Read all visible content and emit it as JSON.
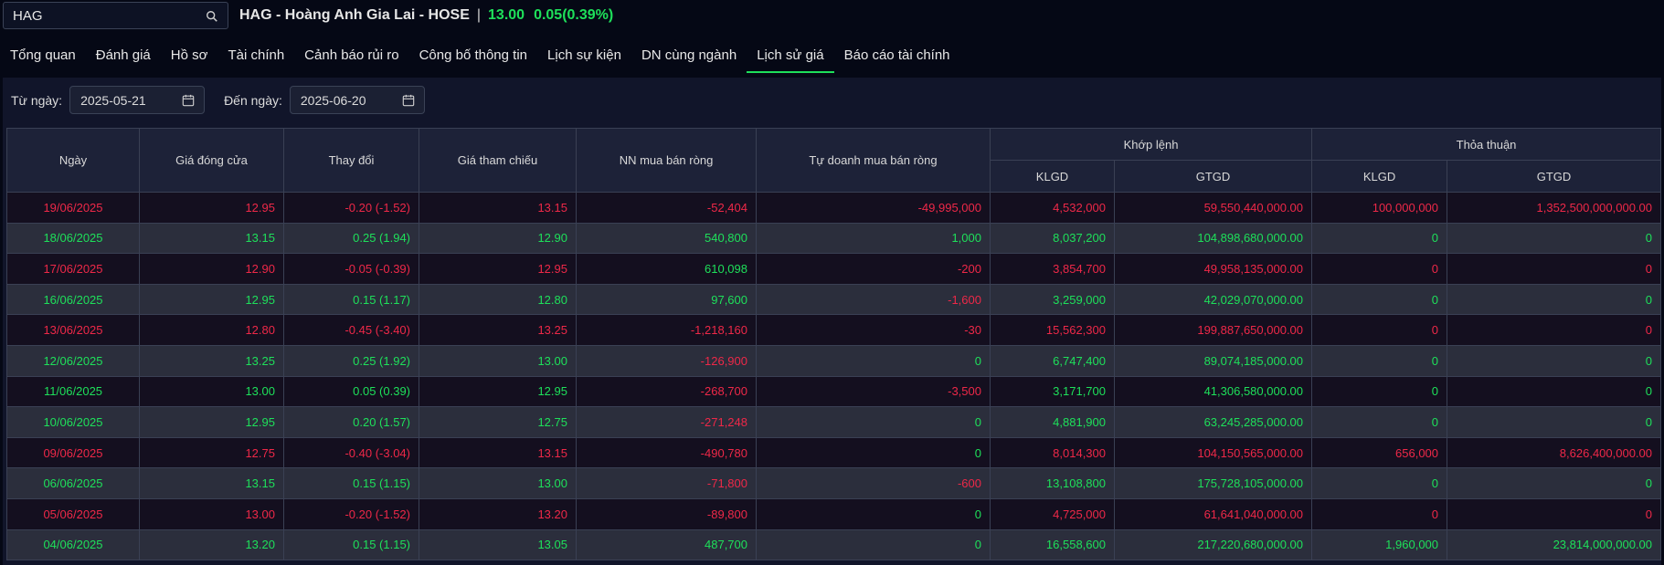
{
  "search": {
    "value": "HAG"
  },
  "header": {
    "stock_title": "HAG - Hoàng Anh Gia Lai - HOSE",
    "separator": "|",
    "price": "13.00",
    "change": "0.05(0.39%)"
  },
  "tabs": [
    "Tổng quan",
    "Đánh giá",
    "Hồ sơ",
    "Tài chính",
    "Cảnh báo rủi ro",
    "Công bố thông tin",
    "Lịch sự kiện",
    "DN cùng ngành",
    "Lịch sử giá",
    "Báo cáo tài chính"
  ],
  "active_tab": "Lịch sử giá",
  "filters": {
    "from_label": "Từ ngày:",
    "from_value": "2025-05-21",
    "to_label": "Đến ngày:",
    "to_value": "2025-06-20"
  },
  "table": {
    "headers": {
      "date": "Ngày",
      "close": "Giá đóng cửa",
      "change": "Thay đổi",
      "ref": "Giá tham chiếu",
      "foreign": "NN mua bán ròng",
      "prop": "Tự doanh mua bán ròng",
      "matched_group": "Khớp lệnh",
      "deal_group": "Thỏa thuận",
      "klgd": "KLGD",
      "gtgd": "GTGD"
    },
    "rows": [
      {
        "dir": "down",
        "cells": [
          "19/06/2025",
          "12.95",
          "-0.20 (-1.52)",
          "13.15",
          "-52,404",
          "-49,995,000",
          "4,532,000",
          "59,550,440,000.00",
          "100,000,000",
          "1,352,500,000,000.00"
        ]
      },
      {
        "dir": "up",
        "cells": [
          "18/06/2025",
          "13.15",
          "0.25 (1.94)",
          "12.90",
          "540,800",
          "1,000",
          "8,037,200",
          "104,898,680,000.00",
          "0",
          "0"
        ]
      },
      {
        "dir": "down",
        "cells": [
          "17/06/2025",
          "12.90",
          "-0.05 (-0.39)",
          "12.95",
          "610,098",
          "-200",
          "3,854,700",
          "49,958,135,000.00",
          "0",
          "0"
        ]
      },
      {
        "dir": "up",
        "cells": [
          "16/06/2025",
          "12.95",
          "0.15 (1.17)",
          "12.80",
          "97,600",
          "-1,600",
          "3,259,000",
          "42,029,070,000.00",
          "0",
          "0"
        ]
      },
      {
        "dir": "down",
        "cells": [
          "13/06/2025",
          "12.80",
          "-0.45 (-3.40)",
          "13.25",
          "-1,218,160",
          "-30",
          "15,562,300",
          "199,887,650,000.00",
          "0",
          "0"
        ]
      },
      {
        "dir": "up",
        "cells": [
          "12/06/2025",
          "13.25",
          "0.25 (1.92)",
          "13.00",
          "-126,900",
          "0",
          "6,747,400",
          "89,074,185,000.00",
          "0",
          "0"
        ]
      },
      {
        "dir": "up",
        "cells": [
          "11/06/2025",
          "13.00",
          "0.05 (0.39)",
          "12.95",
          "-268,700",
          "-3,500",
          "3,171,700",
          "41,306,580,000.00",
          "0",
          "0"
        ]
      },
      {
        "dir": "up",
        "cells": [
          "10/06/2025",
          "12.95",
          "0.20 (1.57)",
          "12.75",
          "-271,248",
          "0",
          "4,881,900",
          "63,245,285,000.00",
          "0",
          "0"
        ]
      },
      {
        "dir": "down",
        "cells": [
          "09/06/2025",
          "12.75",
          "-0.40 (-3.04)",
          "13.15",
          "-490,780",
          "0",
          "8,014,300",
          "104,150,565,000.00",
          "656,000",
          "8,626,400,000.00"
        ]
      },
      {
        "dir": "up",
        "cells": [
          "06/06/2025",
          "13.15",
          "0.15 (1.15)",
          "13.00",
          "-71,800",
          "-600",
          "13,108,800",
          "175,728,105,000.00",
          "0",
          "0"
        ]
      },
      {
        "dir": "down",
        "cells": [
          "05/06/2025",
          "13.00",
          "-0.20 (-1.52)",
          "13.20",
          "-89,800",
          "0",
          "4,725,000",
          "61,641,040,000.00",
          "0",
          "0"
        ]
      },
      {
        "dir": "up",
        "cells": [
          "04/06/2025",
          "13.20",
          "0.15 (1.15)",
          "13.05",
          "487,700",
          "0",
          "16,558,600",
          "217,220,680,000.00",
          "1,960,000",
          "23,814,000,000.00"
        ]
      }
    ]
  },
  "colors": {
    "up": "#1ee05a",
    "down": "#ee2848",
    "accent": "#1ee05a",
    "background": "#050815"
  },
  "icons": {
    "search": "search-icon",
    "calendar": "calendar-icon"
  }
}
